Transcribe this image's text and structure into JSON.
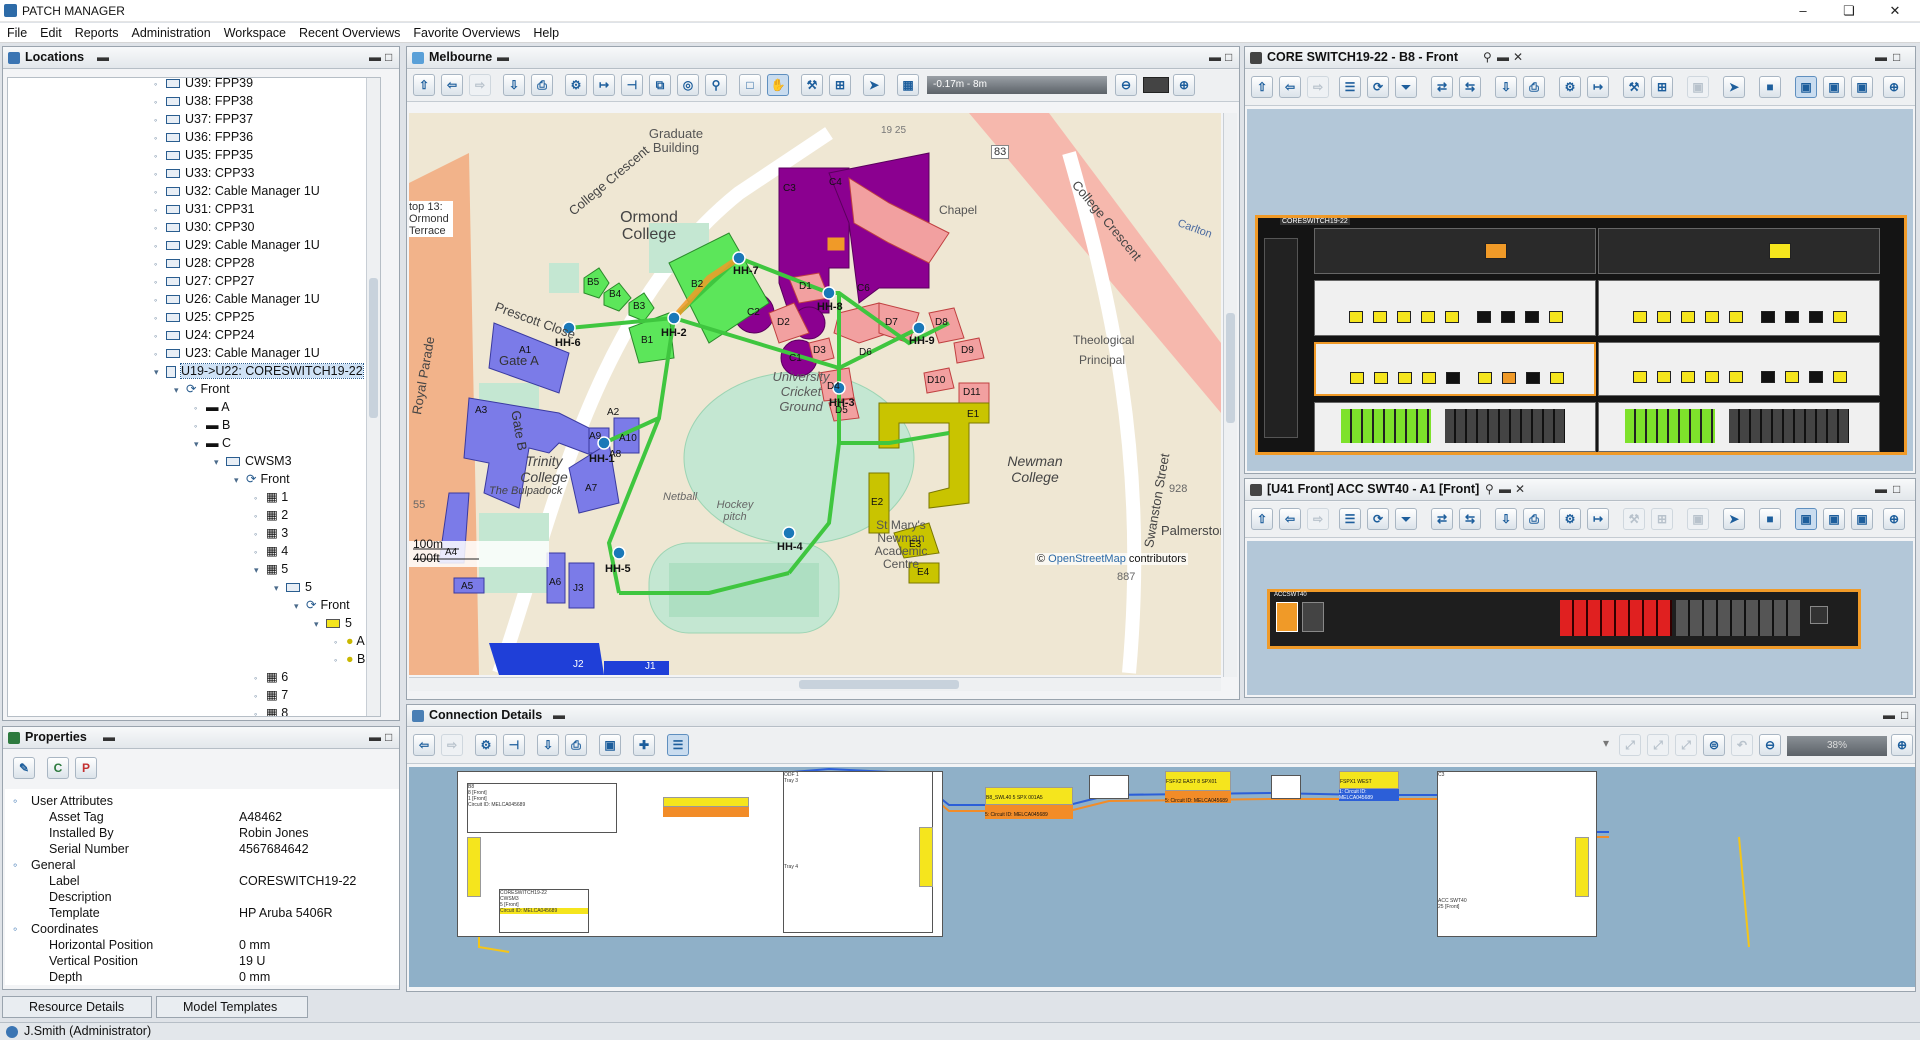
{
  "app": {
    "title": "PATCH MANAGER"
  },
  "menu": [
    "File",
    "Edit",
    "Reports",
    "Administration",
    "Workspace",
    "Recent Overviews",
    "Favorite Overviews",
    "Help"
  ],
  "locations": {
    "title": "Locations",
    "items": [
      {
        "label": "U39: FPP39"
      },
      {
        "label": "U38: FPP38"
      },
      {
        "label": "U37: FPP37"
      },
      {
        "label": "U36: FPP36"
      },
      {
        "label": "U35: FPP35"
      },
      {
        "label": "U33: CPP33"
      },
      {
        "label": "U32: Cable Manager 1U"
      },
      {
        "label": "U31: CPP31"
      },
      {
        "label": "U30: CPP30"
      },
      {
        "label": "U29: Cable Manager 1U"
      },
      {
        "label": "U28: CPP28"
      },
      {
        "label": "U27: CPP27"
      },
      {
        "label": "U26: Cable Manager 1U"
      },
      {
        "label": "U25: CPP25"
      },
      {
        "label": "U24: CPP24"
      },
      {
        "label": "U23: Cable Manager 1U"
      },
      {
        "label": "U19->U22: CORESWITCH19-22"
      },
      {
        "label": "Front"
      },
      {
        "label": "A"
      },
      {
        "label": "B"
      },
      {
        "label": "C"
      },
      {
        "label": "CWSM3"
      },
      {
        "label": "Front"
      },
      {
        "label": "1"
      },
      {
        "label": "2"
      },
      {
        "label": "3"
      },
      {
        "label": "4"
      },
      {
        "label": "5"
      },
      {
        "label": "5"
      },
      {
        "label": "Front"
      },
      {
        "label": "5"
      },
      {
        "label": "A"
      },
      {
        "label": "B"
      },
      {
        "label": "6"
      },
      {
        "label": "7"
      },
      {
        "label": "8"
      }
    ]
  },
  "properties": {
    "title": "Properties",
    "groups": [
      {
        "name": "User Attributes",
        "rows": [
          [
            "Asset Tag",
            "A48462"
          ],
          [
            "Installed By",
            "Robin Jones"
          ],
          [
            "Serial Number",
            "4567684642"
          ]
        ]
      },
      {
        "name": "General",
        "rows": [
          [
            "Label",
            "CORESWITCH19-22"
          ],
          [
            "Description",
            ""
          ],
          [
            "Template",
            "HP Aruba 5406R"
          ]
        ]
      },
      {
        "name": "Coordinates",
        "rows": [
          [
            "Horizontal Position",
            "0 mm"
          ],
          [
            "Vertical Position",
            "19 U"
          ],
          [
            "Depth",
            "0 mm"
          ]
        ]
      }
    ]
  },
  "map": {
    "title": "Melbourne",
    "zoom_range": "-0.17m - 8m",
    "scale_100": "100m",
    "scale_400": "400ft",
    "attribution_prefix": "©",
    "attribution_link": "OpenStreetMap",
    "attribution_suffix": "contributors",
    "labels": [
      "Graduate Building",
      "College Crescent",
      "Ormond College",
      "Royal Parade",
      "Prescott Close",
      "Gate A",
      "Gate B",
      "Trinity College",
      "The Bulpadock",
      "University Cricket Ground",
      "Netball",
      "Hockey pitch",
      "St Mary's Newman Academic Centre",
      "Newman College",
      "Swanston Street",
      "Palmerston",
      "Theological",
      "Principal",
      "Chapel",
      "Carlton",
      "College Crescent",
      "83",
      "19 25",
      "55",
      "928",
      "887",
      "top 13: Ormond Terrace"
    ],
    "buildings": [
      "C3",
      "C4",
      "C2",
      "C6",
      "C1",
      "B2",
      "B5",
      "B4",
      "B3",
      "B1",
      "A1",
      "A2",
      "A3",
      "A9",
      "A10",
      "A8",
      "A7",
      "A6",
      "A5",
      "A4",
      "J3",
      "J2",
      "J1",
      "D1",
      "D2",
      "D3",
      "D6",
      "D7",
      "D8",
      "D9",
      "D10",
      "D11",
      "D4",
      "D5",
      "E1",
      "E2",
      "E3",
      "E4"
    ],
    "nodes": [
      "HH-2",
      "HH-7",
      "HH-8",
      "HH-9",
      "HH-1",
      "HH-3",
      "HH-4",
      "HH-5",
      "HH-6"
    ]
  },
  "core_switch": {
    "title": "CORE SWITCH19-22 - B8 - Front",
    "device_label": "CORESWITCH19-22"
  },
  "acc_switch": {
    "title": "[U41 Front] ACC SWT40 - A1 [Front]",
    "device_label": "ACCSWT40"
  },
  "connection": {
    "title": "Connection Details",
    "zoom": "38%",
    "boxes": [
      {
        "title": "B8",
        "rows": [
          "8 [Front]",
          "1 [Front]",
          "Circuit ID: MELCA045689"
        ]
      },
      {
        "title": "CORESWITCH19-22",
        "rows": [
          "CWSM3",
          "5 [Front]",
          "Circuit ID: MELCA045689"
        ]
      },
      {
        "title": "ODF 1",
        "rows": [
          "Tray 3",
          "Tray 4"
        ]
      },
      {
        "title": "B8_SWL40 5 SPX 001A5",
        "rows": [
          "5: Circuit ID: MELCA045689"
        ]
      },
      {
        "title": "FSFX2 EAST 8 SPX01",
        "rows": [
          "5: Circuit ID: MELCA045689"
        ]
      },
      {
        "title": "FSPX1 WEST",
        "rows": [
          "1: Circuit ID: MELCA045689"
        ]
      },
      {
        "title": "C3",
        "rows": [
          "ACC SWT40",
          "25 [Front]"
        ]
      }
    ]
  },
  "bottom_tabs": [
    "Resource Details",
    "Model Templates"
  ],
  "status": "J.Smith (Administrator)",
  "colors": {
    "accent": "#f09a28",
    "building_purple": "#8b0090",
    "building_green": "#5ce65a",
    "building_blue": "#7b7be8",
    "building_yellow": "#c9c400",
    "building_pink": "#f2a0a0",
    "route": "#3fc63f"
  }
}
